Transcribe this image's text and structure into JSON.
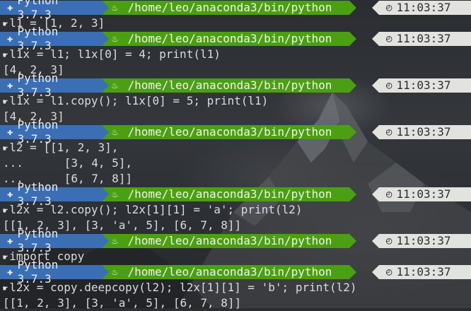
{
  "colors": {
    "python_segment": "#3b6fb5",
    "path_segment": "#4aa012",
    "time_segment": "#e2e2de",
    "text": "#d9dde0"
  },
  "prompt": {
    "python": "Python 3.7.3",
    "path": "/home/leo/anaconda3/bin/python",
    "time": "11:03:37",
    "icons": {
      "python": "python-icon",
      "path": "flame-icon",
      "time": "clock-icon",
      "input": "hand-pointer-icon"
    }
  },
  "blocks": [
    {
      "inputs": [
        "l1 = [1, 2, 3]"
      ],
      "outputs": []
    },
    {
      "inputs": [
        "l1x = l1; l1x[0] = 4; print(l1)"
      ],
      "outputs": [
        "[4, 2, 3]"
      ]
    },
    {
      "inputs": [
        "l1x = l1.copy(); l1x[0] = 5; print(l1)"
      ],
      "outputs": [
        "[4, 2, 3]"
      ]
    },
    {
      "inputs": [
        "l2 = [[1, 2, 3],",
        "...      [3, 4, 5],",
        "...      [6, 7, 8]]"
      ],
      "outputs": []
    },
    {
      "inputs": [
        "l2x = l2.copy(); l2x[1][1] = 'a'; print(l2)"
      ],
      "outputs": [
        "[[1, 2, 3], [3, 'a', 5], [6, 7, 8]]"
      ]
    },
    {
      "inputs": [
        "import copy"
      ],
      "outputs": []
    },
    {
      "inputs": [
        "l2x = copy.deepcopy(l2); l2x[1][1] = 'b'; print(l2)"
      ],
      "outputs": [
        "[[1, 2, 3], [3, 'a', 5], [6, 7, 8]]"
      ]
    }
  ]
}
